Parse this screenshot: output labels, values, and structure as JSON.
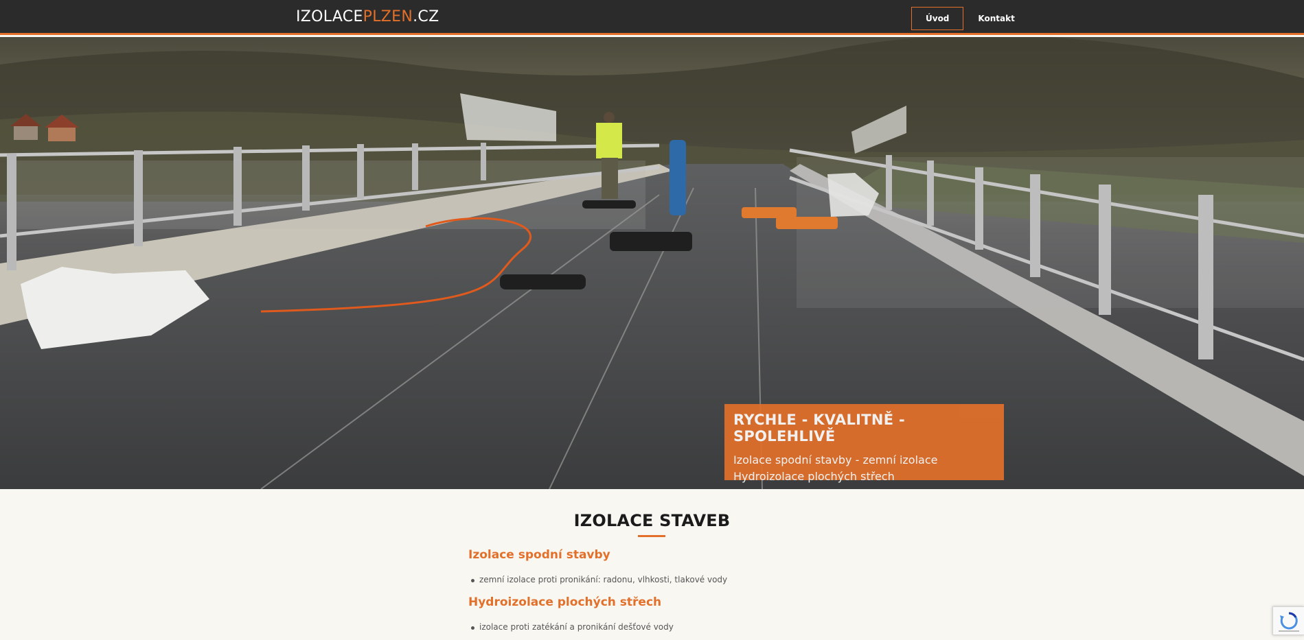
{
  "header": {
    "logo_part1": "IZOLACE",
    "logo_part2": "PLZEN",
    "logo_part3": ".CZ",
    "nav": [
      {
        "label": "Úvod",
        "active": true
      },
      {
        "label": "Kontakt",
        "active": false
      }
    ]
  },
  "hero": {
    "headline": "RYCHLE - KVALITNĚ - SPOLEHLIVĚ",
    "line1": "Izolace spodní stavby - zemní izolace",
    "line2": "Hydroizolace plochých střech"
  },
  "main": {
    "title": "IZOLACE STAVEB",
    "sections": [
      {
        "heading": "Izolace spodní stavby",
        "bullet": "zemní izolace proti pronikání: radonu, vlhkosti, tlakové vody"
      },
      {
        "heading": "Hydroizolace plochých střech",
        "bullet": "izolace proti zatékání a pronikání dešťové vody"
      }
    ]
  },
  "colors": {
    "accent": "#e2702a",
    "header_bg": "#2b2b2b",
    "page_bg": "#f9f7f2"
  },
  "icons": [
    "recaptcha-icon"
  ]
}
